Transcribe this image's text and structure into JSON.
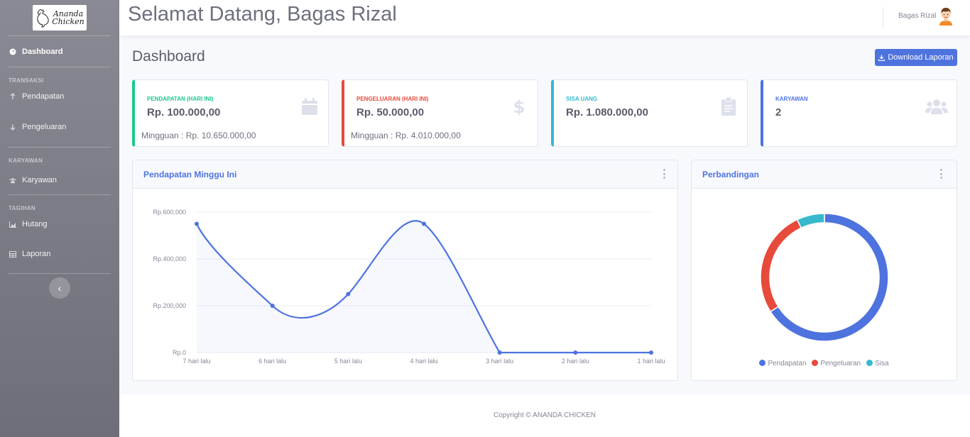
{
  "brand": {
    "logo_text": "Ananda Chicken"
  },
  "sidebar": {
    "items": [
      {
        "label": "Dashboard",
        "icon": "gauge-icon"
      },
      {
        "label": "Pendapatan",
        "icon": "arrow-up-icon"
      },
      {
        "label": "Pengeluaran",
        "icon": "arrow-down-icon"
      },
      {
        "label": "Karyawan",
        "icon": "users-icon"
      },
      {
        "label": "Hutang",
        "icon": "chart-area-icon"
      },
      {
        "label": "Laporan",
        "icon": "table-icon"
      }
    ],
    "headings": [
      "TRANSAKSI",
      "KARYAWAN",
      "TAGIHAN"
    ],
    "toggle_glyph": "‹"
  },
  "topbar": {
    "welcome": "Selamat Datang, Bagas Rizal",
    "user_name": "Bagas Rizal"
  },
  "page": {
    "title": "Dashboard",
    "download_label": "Download Laporan"
  },
  "stats": [
    {
      "label": "PENDAPATAN (HARI INI)",
      "value": "Rp. 100.000,00",
      "sub": "Mingguan : Rp. 10.650.000,00",
      "color": "#1cc88a",
      "icon": "calendar-icon"
    },
    {
      "label": "PENGELUARAN (HARI INI)",
      "value": "Rp. 50.000,00",
      "sub": "Mingguan : Rp. 4.010.000,00",
      "color": "#e74a3b",
      "icon": "dollar-icon"
    },
    {
      "label": "SISA UANG",
      "value": "Rp. 1.080.000,00",
      "sub": "",
      "color": "#36b9cc",
      "icon": "clipboard-icon"
    },
    {
      "label": "KARYAWAN",
      "value": "2",
      "sub": "",
      "color": "#4e73df",
      "icon": "users-icon"
    }
  ],
  "area_panel": {
    "title": "Pendapatan Minggu Ini"
  },
  "pie_panel": {
    "title": "Perbandingan"
  },
  "chart_data": [
    {
      "type": "area",
      "title": "Pendapatan Minggu Ini",
      "categories": [
        "7 hari lalu",
        "6 hari lalu",
        "5 hari lalu",
        "4 hari lalu",
        "3 hari lalu",
        "2 hari lalu",
        "1 hari lalu"
      ],
      "values": [
        550000,
        200000,
        250000,
        550000,
        0,
        0,
        0
      ],
      "yticks": [
        "Rp.0",
        "Rp.200,000",
        "Rp.400,000",
        "Rp.600,000"
      ],
      "ylim": [
        0,
        600000
      ],
      "color": "#4e73df",
      "grid": true
    },
    {
      "type": "pie",
      "title": "Perbandingan",
      "labels": [
        "Pendapatan",
        "Pengeluaran",
        "Sisa"
      ],
      "values": [
        66,
        27,
        7
      ],
      "colors": [
        "#4e73df",
        "#e74a3b",
        "#36b9cc"
      ],
      "legend": "bottom"
    }
  ],
  "footer": {
    "copyright": "Copyright © ANANDA CHICKEN"
  }
}
